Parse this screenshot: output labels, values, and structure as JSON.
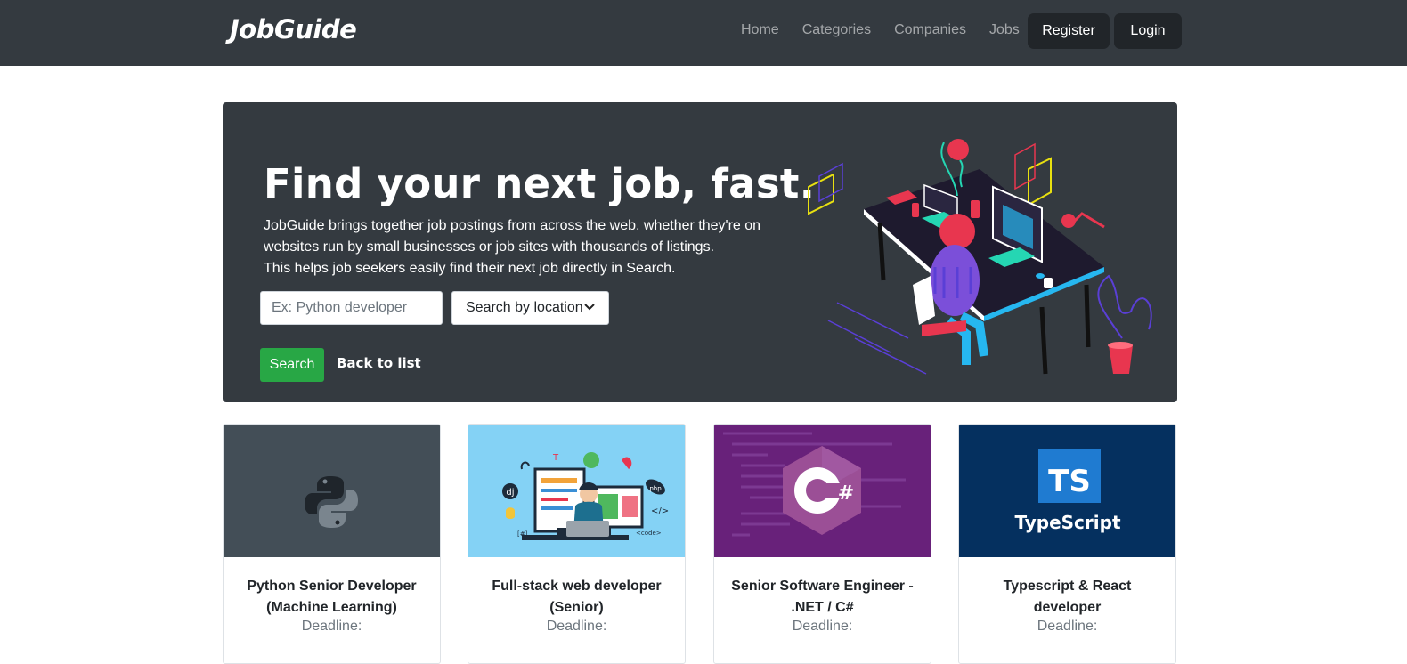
{
  "brand": "JobGuide",
  "nav": {
    "links": [
      "Home",
      "Categories",
      "Companies",
      "Jobs"
    ],
    "register": "Register",
    "login": "Login"
  },
  "hero": {
    "title": "Find your next job, fast.",
    "text_lines": [
      "JobGuide brings together job postings from across the web, whether they're on",
      "websites run by small businesses or job sites with thousands of listings.",
      "This helps job seekers easily find their next job directly in Search."
    ],
    "search_placeholder": "Ex: Python developer",
    "location_select": "Search by location",
    "search_button": "Search",
    "back_link": "Back to list"
  },
  "jobs": [
    {
      "title": "Python Senior Developer (Machine Learning)",
      "deadline_label": "Deadline:",
      "image_icon": "python-logo"
    },
    {
      "title": "Full-stack web developer (Senior)",
      "deadline_label": "Deadline:",
      "image_icon": "developer-illustration",
      "image_labels": [
        "dj",
        "T",
        "</>",
        "<code>",
        "php",
        "[#]"
      ]
    },
    {
      "title": "Senior Software Engineer - .NET / C#",
      "deadline_label": "Deadline:",
      "image_icon": "csharp-logo",
      "image_text": "C#"
    },
    {
      "title": "Typescript & React developer",
      "deadline_label": "Deadline:",
      "image_icon": "typescript-logo",
      "image_badge": "TS",
      "image_text": "TypeScript"
    }
  ],
  "colors": {
    "navbar": "#343a40",
    "hero": "#343a40",
    "search_button": "#28a745",
    "card1_bg": "#434e57",
    "card2_bg": "#84d2f5",
    "card3_bg": "#68217a",
    "card4_bg": "#05305f"
  }
}
